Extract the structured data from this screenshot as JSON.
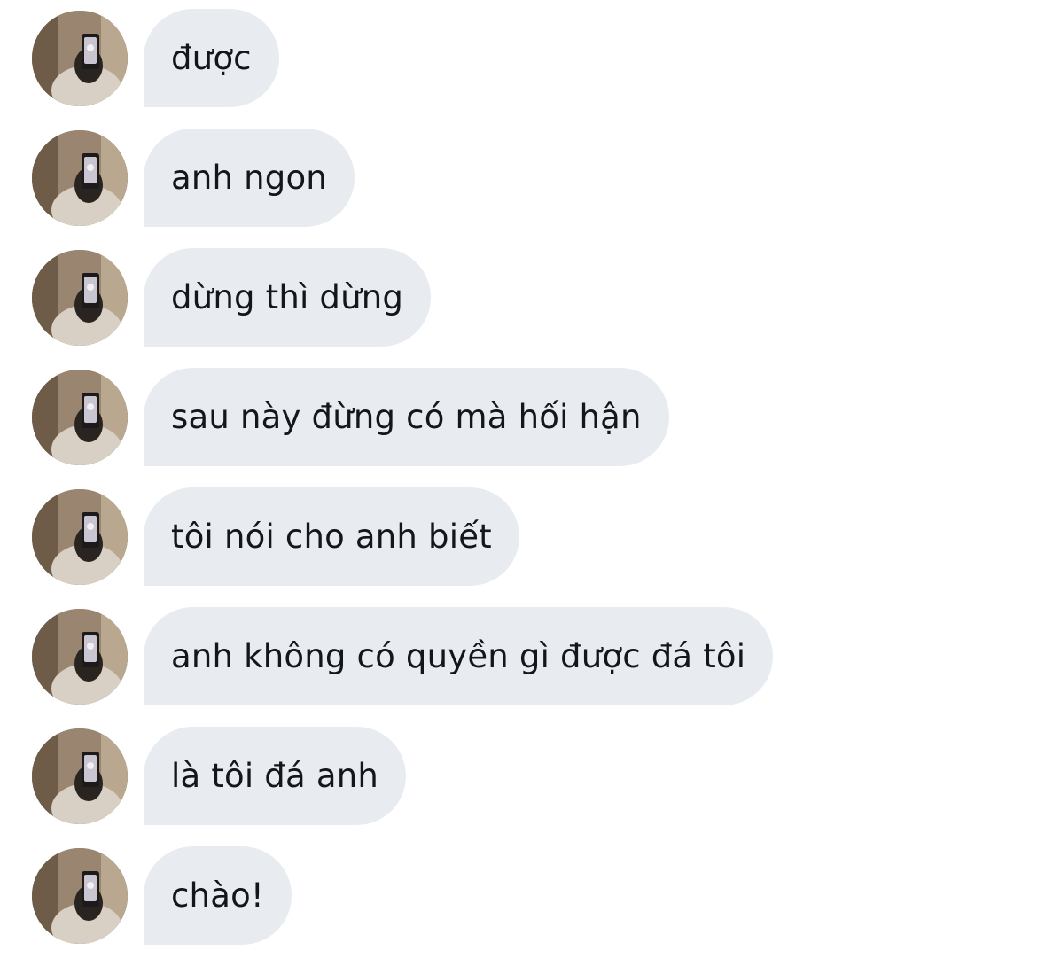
{
  "conversation": {
    "sender": {
      "avatar_icon": "profile-photo-mirror-selfie"
    },
    "messages": [
      {
        "text": "được"
      },
      {
        "text": "anh ngon"
      },
      {
        "text": "dừng thì dừng"
      },
      {
        "text": "sau này đừng có mà hối hận"
      },
      {
        "text": "tôi nói cho anh biết"
      },
      {
        "text": "anh không có quyền gì được đá tôi"
      },
      {
        "text": "là tôi đá anh"
      },
      {
        "text": "chào!"
      }
    ]
  },
  "colors": {
    "background": "#ffffff",
    "bubble": "#e8ecf0",
    "text": "#14171a"
  }
}
